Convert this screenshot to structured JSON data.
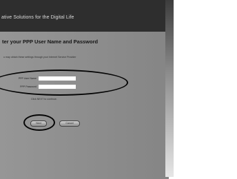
{
  "header": {
    "tagline": "ative Solutions for the Digital Life"
  },
  "panel": {
    "title": "ter your PPP User Name and Password",
    "instructions": "u may obtain these settings through your Internet Service Provider"
  },
  "form": {
    "user_label": "PPP User Name",
    "password_label": "PPP Password",
    "user_value": "",
    "password_value": "",
    "hint": "Click NEXT to continue."
  },
  "buttons": {
    "next_label": "Next",
    "cancel_label": "Cancel"
  }
}
